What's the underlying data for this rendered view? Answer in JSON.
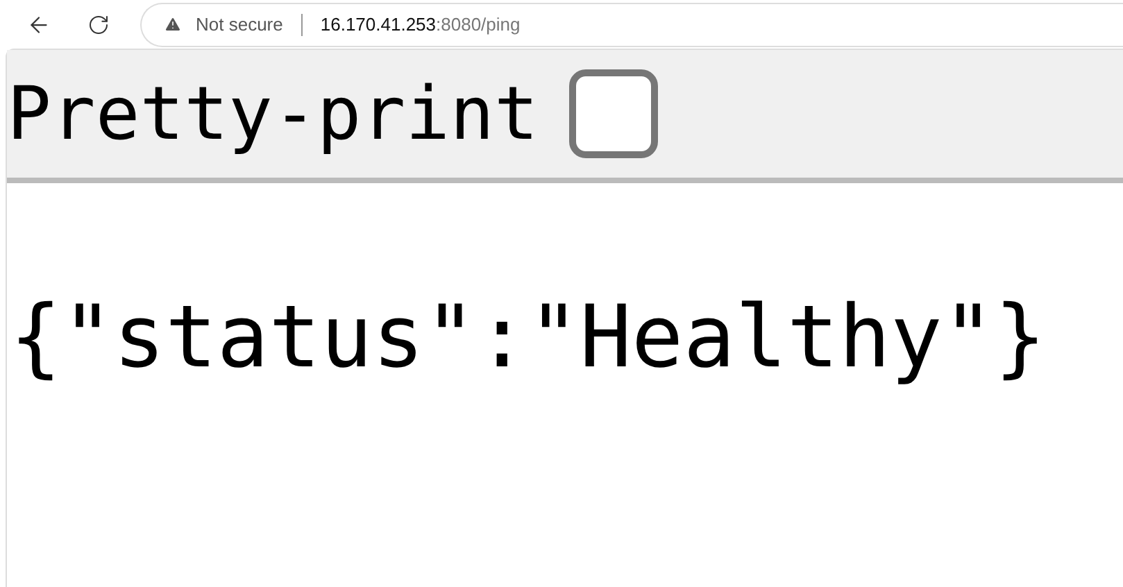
{
  "browser": {
    "security_label": "Not secure",
    "url_host": "16.170.41.253",
    "url_rest": ":8080/ping"
  },
  "pretty_print": {
    "label": "Pretty-print",
    "checked": false
  },
  "body": "{\"status\":\"Healthy\"}"
}
